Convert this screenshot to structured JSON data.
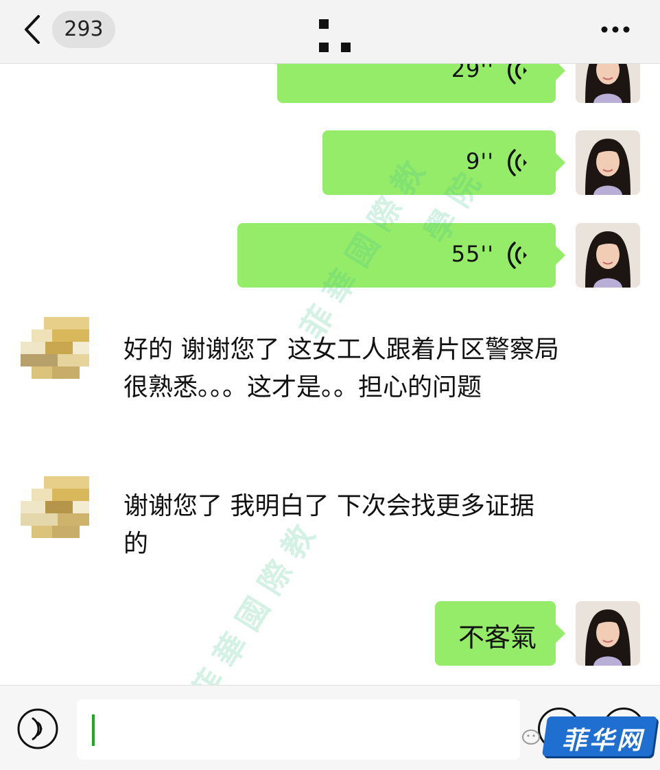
{
  "header": {
    "back_icon": "chevron-left-icon",
    "unread_count": "293",
    "more_icon": "more-dots-icon"
  },
  "messages": [
    {
      "side": "right",
      "type": "voice",
      "duration": "29''"
    },
    {
      "side": "right",
      "type": "voice",
      "duration": "9''"
    },
    {
      "side": "right",
      "type": "voice",
      "duration": "55''"
    },
    {
      "side": "left",
      "type": "text",
      "text": "好的 谢谢您了  这女工人跟着片区警察局很熟悉。。。这才是。。担心的问题"
    },
    {
      "side": "left",
      "type": "text",
      "text": "谢谢您了 我明白了 下次会找更多证据的"
    },
    {
      "side": "right",
      "type": "text",
      "text": "不客氣"
    }
  ],
  "watermarks": [
    "菲 華 國 際 教",
    "學 院",
    "菲 華 國 際 教"
  ],
  "input_bar": {
    "voice_icon": "voice-toggle-icon",
    "input_value": ""
  },
  "logo": {
    "text": "菲华网"
  },
  "colors": {
    "my_bubble": "#95ec69",
    "header_bg": "#f3f3f3",
    "caret": "#1aad19",
    "logo_blue": "#1f6fd1"
  }
}
